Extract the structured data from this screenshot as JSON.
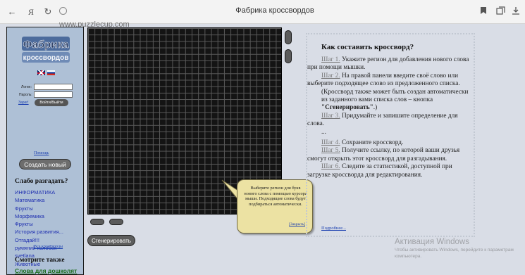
{
  "browser": {
    "url": "www.puzzlecup.com",
    "tab_title": "Фабрика кроссвордов",
    "back_glyph": "←",
    "browser_logo": "Я",
    "reload_glyph": "↻"
  },
  "sidebar": {
    "logo_top": "Фабрика",
    "logo_bottom": "кроссвордов",
    "login_label": "Логин:",
    "password_label": "Пароль:",
    "register_link": "Зарег!",
    "login_button": "Войти/Выйти",
    "help_link": "Помощь",
    "create_button": "Создать новый",
    "weak_heading": "Слабо разгадать?",
    "items": [
      "ИНФОРМАТИКА",
      "Математика",
      "Фрукты",
      "Морфемика",
      "Фрукты",
      "История развития...",
      "Отгадай!!!",
      "румяний колобок",
      "svetlana",
      "Животные"
    ],
    "all_link": "Все кроссворды",
    "also_heading": "Смотрите также",
    "also_link": "Слова для дошколят"
  },
  "grid": {
    "generate_button": "Сгенерировать"
  },
  "tooltip": {
    "text": "Выберите регион для букв нового слова с помощью курсора мыши. Подходящие слова будут подбираться автоматически.",
    "close": "[Закрыть]"
  },
  "info": {
    "title": "Как составить кроссворд?",
    "step1_label": "Шаг 1.",
    "step1_text": " Укажите регион для добавления нового слова при помощи мышки.",
    "step2_label": "Шаг 2.",
    "step2_text": " На правой панели введите своё слово или выберите подходящее слово из предложенного списка.",
    "note_start": "(Кроссворд также может быть создан автоматически из заданного вами списка слов – кнопка ",
    "note_button": "\"Сгенерировать\"",
    "note_end": ".)",
    "step3_label": "Шаг 3.",
    "step3_text": " Придумайте и запишите определение для слова.",
    "ellipsis": "...",
    "step4_label": "Шаг 4.",
    "step4_text": " Сохраните кроссворд.",
    "step5_label": "Шаг 5.",
    "step5_text": " Получите ссылку, по которой ваши друзья смогут открыть этот кроссворд для разгадывания.",
    "step6_label": "Шаг 6.",
    "step6_text": " Следите за статистикой, доступной при загрузке кроссворда для редактирования.",
    "more_link": "Подробнее..."
  },
  "watermark": {
    "title": "Активация Windows",
    "text": "Чтобы активировать Windows, перейдите к параметрам компьютера."
  }
}
